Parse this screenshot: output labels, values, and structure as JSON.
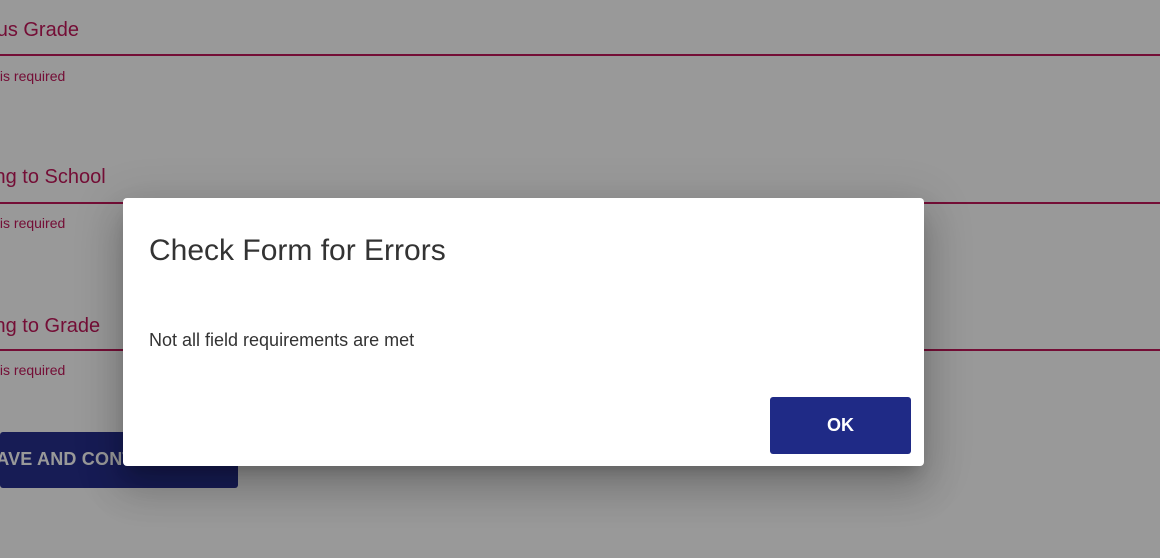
{
  "form": {
    "fields": [
      {
        "label": "Previous Grade",
        "error": "This field is required"
      },
      {
        "label": "Applying to School",
        "error": "This field is required"
      },
      {
        "label": "Applying to Grade",
        "error": "This field is required"
      }
    ],
    "save_label": "SAVE AND CONTINUE"
  },
  "dialog": {
    "title": "Check Form for Errors",
    "message": "Not all field requirements are met",
    "ok_label": "OK"
  },
  "colors": {
    "error": "#c2185b",
    "primary": "#1f2a86",
    "overlay": "rgba(0,0,0,0.40)"
  }
}
